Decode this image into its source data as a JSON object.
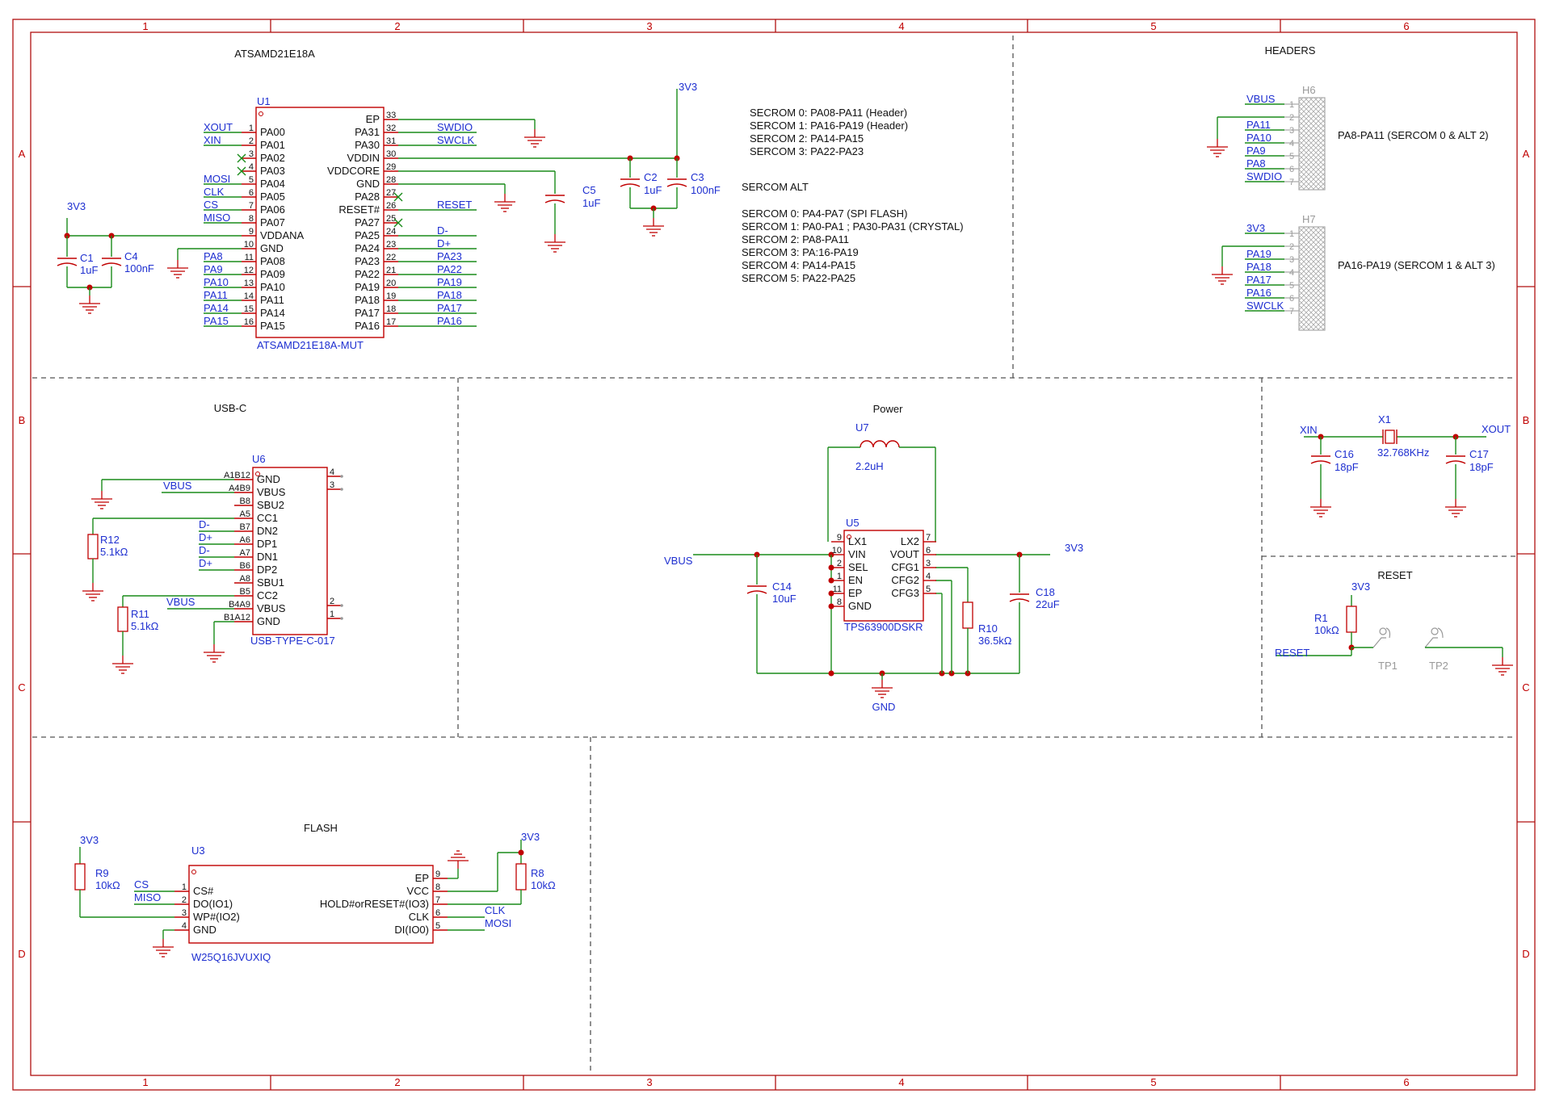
{
  "border": {
    "columns": [
      "1",
      "2",
      "3",
      "4",
      "5",
      "6"
    ],
    "rows": [
      "A",
      "B",
      "C",
      "D"
    ]
  },
  "titles": {
    "mcu": "ATSAMD21E18A",
    "headers": "HEADERS",
    "usbc": "USB-C",
    "power": "Power",
    "reset": "RESET",
    "flash": "FLASH"
  },
  "sercom_notes": {
    "lines": [
      "SECROM 0: PA08-PA11 (Header)",
      "SERCOM 1: PA16-PA19 (Header)",
      "SERCOM 2: PA14-PA15",
      "SERCOM 3: PA22-PA23"
    ],
    "alt_title": "SERCOM ALT",
    "alt_lines": [
      "SERCOM 0: PA4-PA7 (SPI FLASH)",
      "SERCOM 1: PA0-PA1 ; PA30-PA31 (CRYSTAL)",
      "SERCOM 2: PA8-PA11",
      "SERCOM 3: PA:16-PA19",
      "SERCOM 4: PA14-PA15",
      "SERCOM 5: PA22-PA25"
    ]
  },
  "u1": {
    "ref": "U1",
    "part": "ATSAMD21E18A-MUT",
    "left_pins": [
      {
        "num": "1",
        "name": "PA00",
        "net": "XOUT"
      },
      {
        "num": "2",
        "name": "PA01",
        "net": "XIN"
      },
      {
        "num": "3",
        "name": "PA02",
        "net": ""
      },
      {
        "num": "4",
        "name": "PA03",
        "net": ""
      },
      {
        "num": "5",
        "name": "PA04",
        "net": "MOSI"
      },
      {
        "num": "6",
        "name": "PA05",
        "net": "CLK"
      },
      {
        "num": "7",
        "name": "PA06",
        "net": "CS"
      },
      {
        "num": "8",
        "name": "PA07",
        "net": "MISO"
      },
      {
        "num": "9",
        "name": "VDDANA",
        "net": ""
      },
      {
        "num": "10",
        "name": "GND",
        "net": ""
      },
      {
        "num": "11",
        "name": "PA08",
        "net": "PA8"
      },
      {
        "num": "12",
        "name": "PA09",
        "net": "PA9"
      },
      {
        "num": "13",
        "name": "PA10",
        "net": "PA10"
      },
      {
        "num": "14",
        "name": "PA11",
        "net": "PA11"
      },
      {
        "num": "15",
        "name": "PA14",
        "net": "PA14"
      },
      {
        "num": "16",
        "name": "PA15",
        "net": "PA15"
      }
    ],
    "right_pins": [
      {
        "num": "33",
        "name": "EP",
        "net": ""
      },
      {
        "num": "32",
        "name": "PA31",
        "net": "SWDIO"
      },
      {
        "num": "31",
        "name": "PA30",
        "net": "SWCLK"
      },
      {
        "num": "30",
        "name": "VDDIN",
        "net": ""
      },
      {
        "num": "29",
        "name": "VDDCORE",
        "net": ""
      },
      {
        "num": "28",
        "name": "GND",
        "net": ""
      },
      {
        "num": "27",
        "name": "PA28",
        "net": ""
      },
      {
        "num": "26",
        "name": "RESET#",
        "net": "RESET"
      },
      {
        "num": "25",
        "name": "PA27",
        "net": ""
      },
      {
        "num": "24",
        "name": "PA25",
        "net": "D-"
      },
      {
        "num": "23",
        "name": "PA24",
        "net": "D+"
      },
      {
        "num": "22",
        "name": "PA23",
        "net": "PA23"
      },
      {
        "num": "21",
        "name": "PA22",
        "net": "PA22"
      },
      {
        "num": "20",
        "name": "PA19",
        "net": "PA19"
      },
      {
        "num": "19",
        "name": "PA18",
        "net": "PA18"
      },
      {
        "num": "18",
        "name": "PA17",
        "net": "PA17"
      },
      {
        "num": "17",
        "name": "PA16",
        "net": "PA16"
      }
    ]
  },
  "mcu_passives": {
    "c1": {
      "ref": "C1",
      "value": "1uF"
    },
    "c4": {
      "ref": "C4",
      "value": "100nF"
    },
    "c5": {
      "ref": "C5",
      "value": "1uF"
    },
    "c2": {
      "ref": "C2",
      "value": "1uF"
    },
    "c3": {
      "ref": "C3",
      "value": "100nF"
    },
    "rail_left": "3V3",
    "rail_top": "3V3"
  },
  "h6": {
    "ref": "H6",
    "label": "PA8-PA11 (SERCOM 0 & ALT 2)",
    "pins": [
      {
        "num": "1",
        "net": "VBUS"
      },
      {
        "num": "2",
        "net": ""
      },
      {
        "num": "3",
        "net": "PA11"
      },
      {
        "num": "4",
        "net": "PA10"
      },
      {
        "num": "5",
        "net": "PA9"
      },
      {
        "num": "6",
        "net": "PA8"
      },
      {
        "num": "7",
        "net": "SWDIO"
      }
    ]
  },
  "h7": {
    "ref": "H7",
    "label": "PA16-PA19 (SERCOM 1 & ALT 3)",
    "pins": [
      {
        "num": "1",
        "net": "3V3"
      },
      {
        "num": "2",
        "net": ""
      },
      {
        "num": "3",
        "net": "PA19"
      },
      {
        "num": "4",
        "net": "PA18"
      },
      {
        "num": "5",
        "net": "PA17"
      },
      {
        "num": "6",
        "net": "PA16"
      },
      {
        "num": "7",
        "net": "SWCLK"
      }
    ]
  },
  "u6": {
    "ref": "U6",
    "part": "USB-TYPE-C-017",
    "left_pins": [
      {
        "num": "A1B12",
        "name": "GND",
        "net": ""
      },
      {
        "num": "A4B9",
        "name": "VBUS",
        "net": "VBUS"
      },
      {
        "num": "B8",
        "name": "SBU2",
        "net": ""
      },
      {
        "num": "A5",
        "name": "CC1",
        "net": ""
      },
      {
        "num": "B7",
        "name": "DN2",
        "net": "D-"
      },
      {
        "num": "A6",
        "name": "DP1",
        "net": "D+"
      },
      {
        "num": "A7",
        "name": "DN1",
        "net": "D-"
      },
      {
        "num": "B6",
        "name": "DP2",
        "net": "D+"
      },
      {
        "num": "A8",
        "name": "SBU1",
        "net": ""
      },
      {
        "num": "B5",
        "name": "CC2",
        "net": ""
      },
      {
        "num": "B4A9",
        "name": "VBUS",
        "net": "VBUS"
      },
      {
        "num": "B1A12",
        "name": "GND",
        "net": ""
      }
    ],
    "right_pins": [
      "4",
      "3",
      "2",
      "1"
    ],
    "r12": {
      "ref": "R12",
      "value": "5.1kΩ"
    },
    "r11": {
      "ref": "R11",
      "value": "5.1kΩ"
    }
  },
  "power": {
    "inductor": {
      "ref": "U7",
      "value": "2.2uH"
    },
    "u5": {
      "ref": "U5",
      "part": "TPS63900DSKR"
    },
    "left_pins": [
      {
        "num": "9",
        "name": "LX1"
      },
      {
        "num": "10",
        "name": "VIN"
      },
      {
        "num": "2",
        "name": "SEL"
      },
      {
        "num": "1",
        "name": "EN"
      },
      {
        "num": "11",
        "name": "EP"
      },
      {
        "num": "8",
        "name": "GND"
      }
    ],
    "right_pins": [
      {
        "num": "7",
        "name": "LX2"
      },
      {
        "num": "6",
        "name": "VOUT"
      },
      {
        "num": "3",
        "name": "CFG1"
      },
      {
        "num": "4",
        "name": "CFG2"
      },
      {
        "num": "5",
        "name": "CFG3"
      }
    ],
    "vbus": "VBUS",
    "out": "3V3",
    "gnd": "GND",
    "c14": {
      "ref": "C14",
      "value": "10uF"
    },
    "c18": {
      "ref": "C18",
      "value": "22uF"
    },
    "r10": {
      "ref": "R10",
      "value": "36.5kΩ"
    }
  },
  "crystal": {
    "x1": {
      "ref": "X1",
      "value": "32.768KHz"
    },
    "xin": "XIN",
    "xout": "XOUT",
    "c16": {
      "ref": "C16",
      "value": "18pF"
    },
    "c17": {
      "ref": "C17",
      "value": "18pF"
    }
  },
  "reset_block": {
    "rail": "3V3",
    "r1": {
      "ref": "R1",
      "value": "10kΩ"
    },
    "net": "RESET",
    "tp1": "TP1",
    "tp2": "TP2"
  },
  "flash": {
    "u3": {
      "ref": "U3",
      "part": "W25Q16JVUXIQ"
    },
    "left_pins": [
      {
        "num": "1",
        "name": "CS#",
        "net": "CS"
      },
      {
        "num": "2",
        "name": "DO(IO1)",
        "net": "MISO"
      },
      {
        "num": "3",
        "name": "WP#(IO2)",
        "net": ""
      },
      {
        "num": "4",
        "name": "GND",
        "net": ""
      }
    ],
    "right_pins": [
      {
        "num": "9",
        "name": "EP",
        "net": ""
      },
      {
        "num": "8",
        "name": "VCC",
        "net": ""
      },
      {
        "num": "7",
        "name": "HOLD#orRESET#(IO3)",
        "net": ""
      },
      {
        "num": "6",
        "name": "CLK",
        "net": "CLK"
      },
      {
        "num": "5",
        "name": "DI(IO0)",
        "net": "MOSI"
      }
    ],
    "r9": {
      "ref": "R9",
      "value": "10kΩ",
      "rail": "3V3"
    },
    "r8": {
      "ref": "R8",
      "value": "10kΩ",
      "rail": "3V3"
    }
  }
}
